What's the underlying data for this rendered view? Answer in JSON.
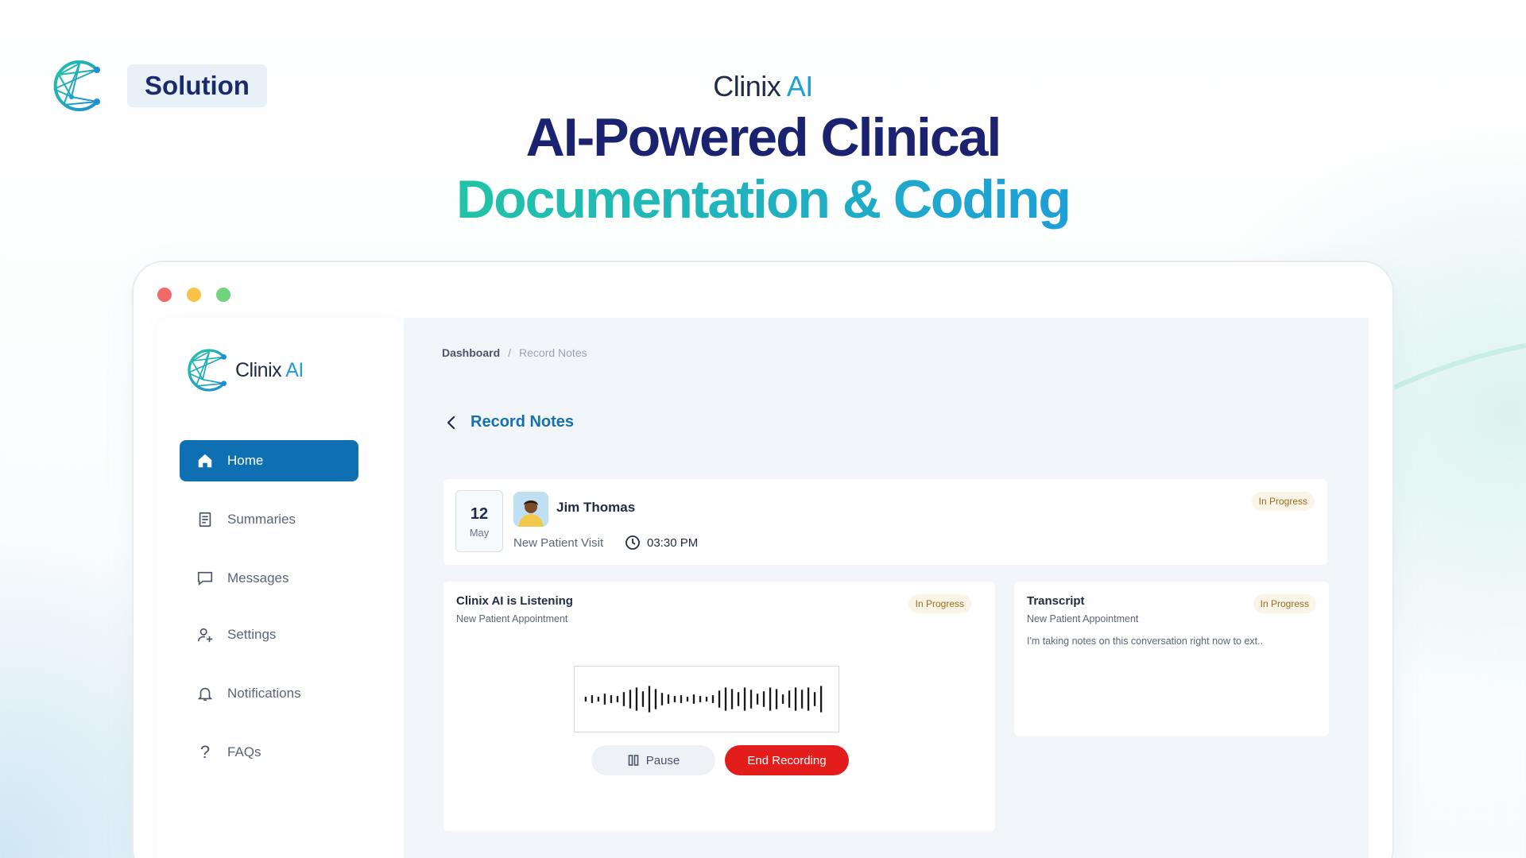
{
  "header": {
    "solution_tag": "Solution",
    "brand_name": "Clinix",
    "brand_suffix": "AI",
    "headline_line1": "AI-Powered Clinical",
    "headline_line2": "Documentation & Coding"
  },
  "sidebar": {
    "brand_name": "Clinix",
    "brand_suffix": "AI",
    "items": [
      {
        "label": "Home",
        "icon": "home-icon",
        "active": true
      },
      {
        "label": "Summaries",
        "icon": "document-icon",
        "active": false
      },
      {
        "label": "Messages",
        "icon": "chat-icon",
        "active": false
      },
      {
        "label": "Settings",
        "icon": "user-settings-icon",
        "active": false
      },
      {
        "label": "Notifications",
        "icon": "bell-icon",
        "active": false
      },
      {
        "label": "FAQs",
        "icon": "question-icon",
        "active": false
      }
    ]
  },
  "breadcrumb": {
    "home": "Dashboard",
    "separator": "/",
    "current": "Record Notes"
  },
  "page_title": "Record Notes",
  "patient": {
    "day": "12",
    "month": "May",
    "name": "Jim Thomas",
    "visit_type": "New Patient Visit",
    "time": "03:30 PM",
    "status": "In Progress"
  },
  "listening": {
    "title": "Clinix AI is Listening",
    "subtitle": "New Patient Appointment",
    "status": "In Progress",
    "pause_label": "Pause",
    "end_label": "End Recording"
  },
  "transcript": {
    "title": "Transcript",
    "subtitle": "New Patient Appointment",
    "status": "In Progress",
    "text": "I'm taking notes on this conversation right now to ext.."
  },
  "colors": {
    "primary": "#0f6fb3",
    "headline_navy": "#1b2270",
    "gradient_start": "#22c3a7",
    "gradient_end": "#1e9fd8",
    "danger": "#e31c1c",
    "badge_bg": "#fbf5e8",
    "badge_text": "#9a6a1c"
  }
}
